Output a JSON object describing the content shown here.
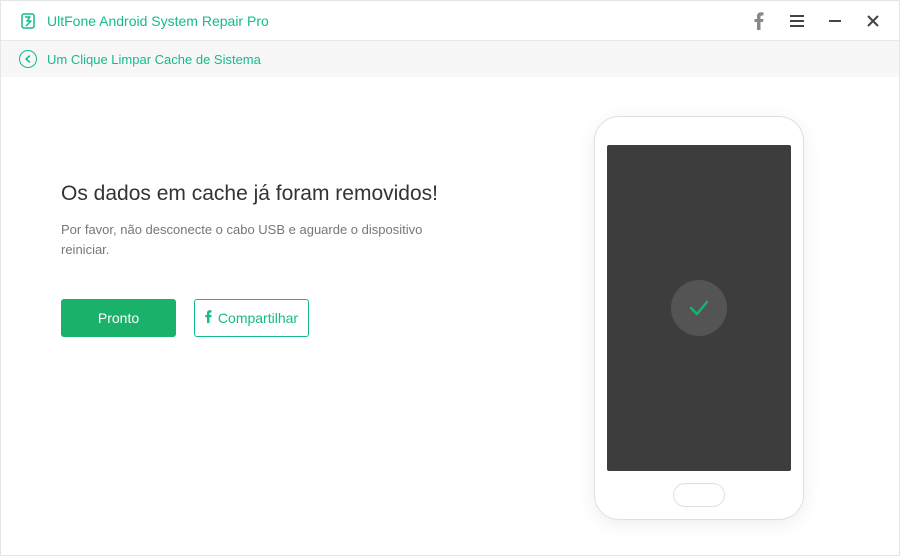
{
  "titlebar": {
    "app_title": "UltFone Android System Repair Pro"
  },
  "breadcrumb": {
    "text": "Um Clique Limpar Cache de Sistema"
  },
  "main": {
    "heading": "Os dados em cache já foram removidos!",
    "subtext": "Por favor, não desconecte o cabo USB e aguarde o dispositivo reiniciar.",
    "btn_primary": "Pronto",
    "btn_secondary": "Compartilhar"
  },
  "colors": {
    "accent": "#15ba8d",
    "primary_btn": "#1ab26b"
  }
}
